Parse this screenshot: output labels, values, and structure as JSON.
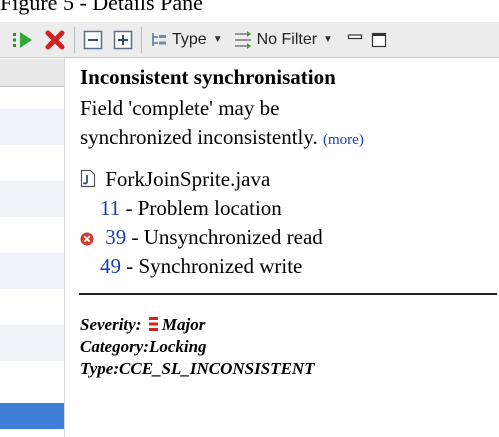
{
  "caption": "Figure 5 - Details Pane",
  "toolbar": {
    "type_label": "Type",
    "filter_label": "No Filter"
  },
  "popup": {
    "title": "Inconsistent synchronisation",
    "description_line1": "Field 'complete' may be",
    "description_line2": "synchronized inconsistently.",
    "more_link": "(more)",
    "file": {
      "icon": "java-file-icon",
      "name": "ForkJoinSprite.java"
    },
    "locations": [
      {
        "line": "11",
        "sep": " - ",
        "text": "Problem location",
        "icon": ""
      },
      {
        "line": "39",
        "sep": " - ",
        "text": "Unsynchronized read",
        "icon": "error-icon"
      },
      {
        "line": "49",
        "sep": " - ",
        "text": "Synchronized write",
        "icon": ""
      }
    ],
    "severity": {
      "label": "Severity:",
      "value": "Major",
      "icon": "major-severity-icon",
      "color": "#d8231a"
    },
    "category": {
      "label": "Category:",
      "value": "Locking"
    },
    "type": {
      "label": "Type:",
      "value": "CCE_SL_INCONSISTENT"
    }
  },
  "colors": {
    "selection": "#3d7fd8",
    "link": "#1a3fb0",
    "error": "#d33a2c"
  }
}
